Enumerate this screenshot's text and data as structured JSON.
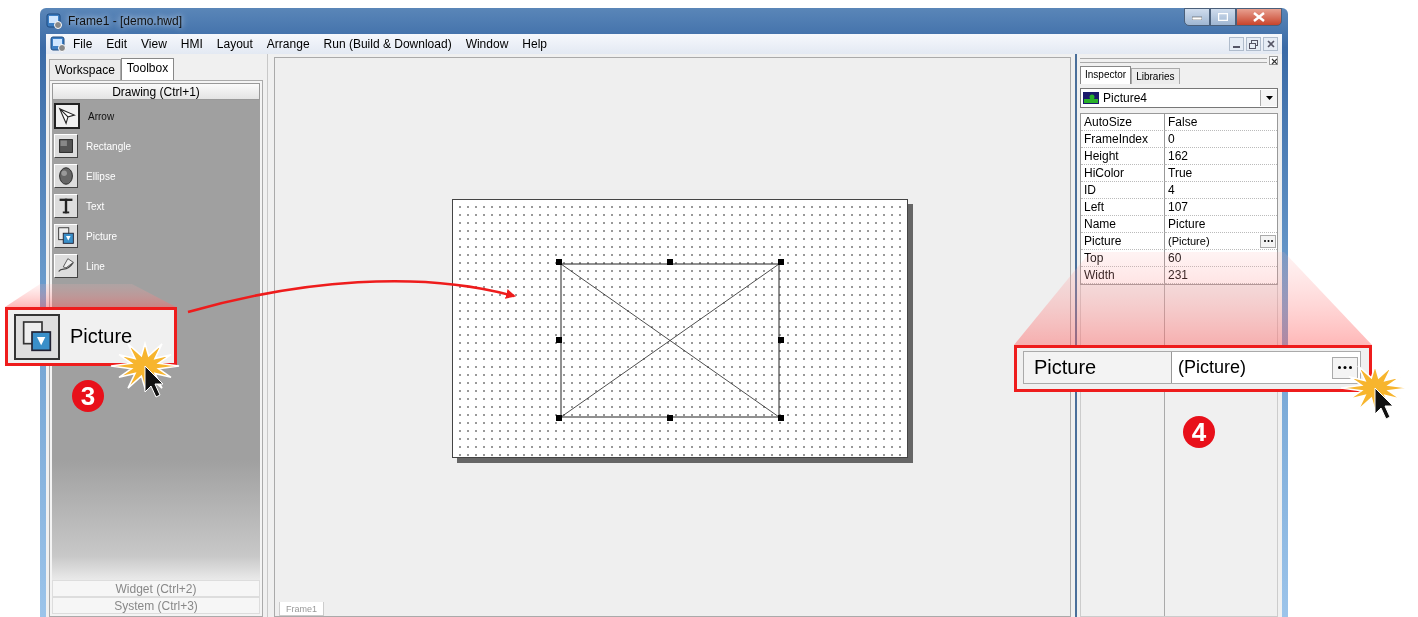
{
  "window": {
    "title": "Frame1 - [demo.hwd]"
  },
  "menu": [
    "File",
    "Edit",
    "View",
    "HMI",
    "Layout",
    "Arrange",
    "Run (Build & Download)",
    "Window",
    "Help"
  ],
  "left_tabs": [
    {
      "label": "Workspace",
      "selected": false
    },
    {
      "label": "Toolbox",
      "selected": true
    }
  ],
  "toolbox": [
    {
      "label": "Drawing (Ctrl+1)",
      "expanded": true,
      "items": [
        {
          "label": "Arrow",
          "kind": "arrow",
          "selected": true
        },
        {
          "label": "Rectangle",
          "kind": "rectangle",
          "selected": false
        },
        {
          "label": "Ellipse",
          "kind": "ellipse",
          "selected": false
        },
        {
          "label": "Text",
          "kind": "text",
          "selected": false
        },
        {
          "label": "Picture",
          "kind": "picture",
          "selected": false
        },
        {
          "label": "Line",
          "kind": "line",
          "selected": false
        }
      ]
    },
    {
      "label": "Widget (Ctrl+2)",
      "expanded": false
    },
    {
      "label": "System (Ctrl+3)",
      "expanded": false
    }
  ],
  "document_tabs": [
    {
      "label": "Frame1",
      "selected": true
    }
  ],
  "inspector": {
    "tabs": [
      {
        "label": "Inspector",
        "selected": true
      },
      {
        "label": "Libraries",
        "selected": false
      }
    ],
    "object": "Picture4",
    "properties": [
      {
        "name": "AutoSize",
        "value": "False",
        "kind": "text"
      },
      {
        "name": "FrameIndex",
        "value": "0",
        "kind": "text"
      },
      {
        "name": "Height",
        "value": "162",
        "kind": "text"
      },
      {
        "name": "HiColor",
        "value": "True",
        "kind": "text"
      },
      {
        "name": "ID",
        "value": "4",
        "kind": "text"
      },
      {
        "name": "Left",
        "value": "107",
        "kind": "text"
      },
      {
        "name": "Name",
        "value": "Picture",
        "kind": "text"
      },
      {
        "name": "Picture",
        "value": "(Picture)",
        "kind": "ellipsis"
      },
      {
        "name": "Top",
        "value": "60",
        "kind": "text"
      },
      {
        "name": "Width",
        "value": "231",
        "kind": "text"
      }
    ]
  },
  "callouts": [
    {
      "step": "3",
      "label": "Picture"
    },
    {
      "step": "4",
      "name": "Picture",
      "value": "(Picture)"
    }
  ]
}
